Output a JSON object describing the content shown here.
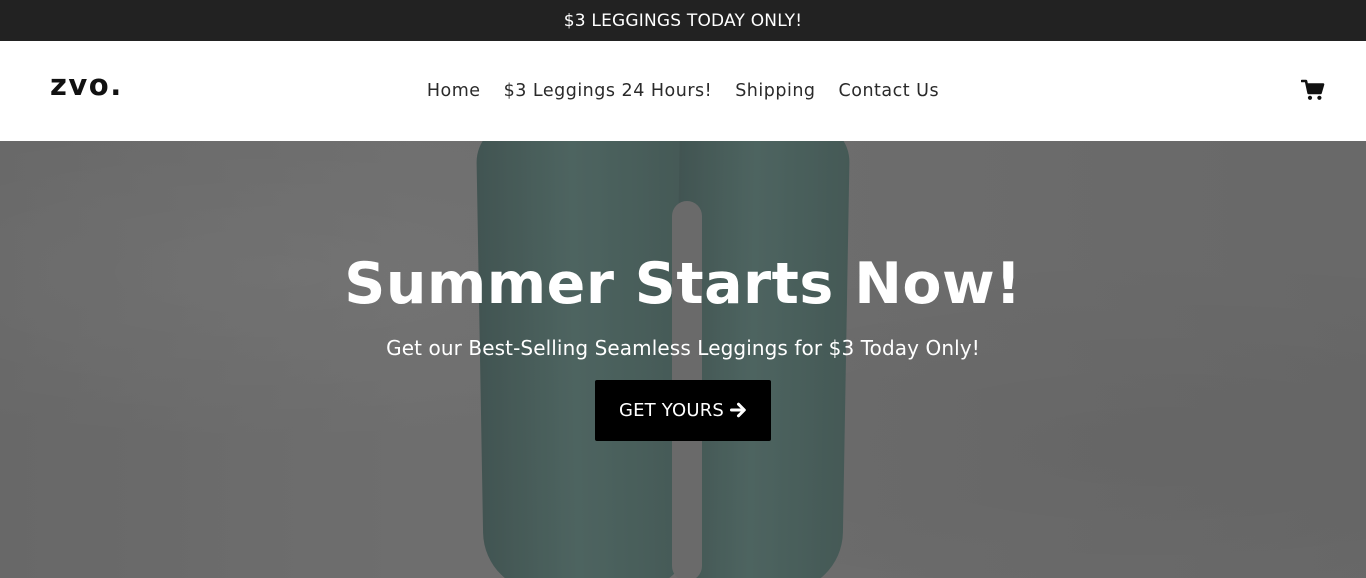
{
  "announcement": {
    "text": "$3 LEGGINGS TODAY ONLY!"
  },
  "header": {
    "logo": "zvo.",
    "nav": [
      {
        "label": "Home"
      },
      {
        "label": "$3 Leggings 24 Hours!"
      },
      {
        "label": "Shipping"
      },
      {
        "label": "Contact Us"
      }
    ],
    "cart_icon": "cart-icon"
  },
  "hero": {
    "title": "Summer Starts Now!",
    "subtitle": "Get our Best-Selling Seamless Leggings for $3 Today Only!",
    "cta_label": "GET YOURS",
    "cta_icon": "arrow-right-icon"
  },
  "colors": {
    "announcement_bg": "#222222",
    "hero_bg": "#707070",
    "legging_green": "#4a6762",
    "cta_bg": "#000000"
  }
}
